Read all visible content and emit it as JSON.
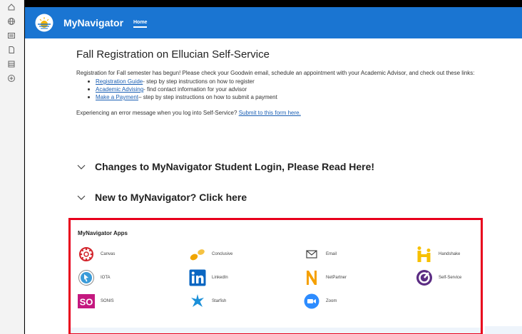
{
  "header": {
    "app_title": "MyNavigator",
    "nav_home": "Home"
  },
  "announcement": {
    "title": "Fall Registration on Ellucian Self-Service",
    "intro": "Registration for Fall semester has begun! Please check your Goodwin email, schedule an appointment with your Academic Advisor, and check out these links:",
    "links": [
      {
        "link": "Registration Guide",
        "desc": " - step by step instructions on how to register"
      },
      {
        "link": "Academic Advising",
        "desc": " - find contact information for your advisor"
      },
      {
        "link": "Make a Payment",
        "desc": " – step by step instructions on how to submit a payment"
      }
    ],
    "error_text": "Experiencing an error message when you log into Self-Service? ",
    "error_link": "Submit to this form here."
  },
  "accordions": [
    "Changes to MyNavigator Student Login, Please Read Here!",
    "New to MyNavigator? Click here"
  ],
  "apps": {
    "title": "MyNavigator Apps",
    "items": [
      {
        "label": "Canvas",
        "icon": "canvas-icon"
      },
      {
        "label": "Conclusive",
        "icon": "conclusive-icon"
      },
      {
        "label": "Email",
        "icon": "email-icon"
      },
      {
        "label": "Handshake",
        "icon": "handshake-icon"
      },
      {
        "label": "IOTA",
        "icon": "iota-icon"
      },
      {
        "label": "LinkedIn",
        "icon": "linkedin-icon"
      },
      {
        "label": "NetPartner",
        "icon": "netpartner-icon"
      },
      {
        "label": "Self-Service",
        "icon": "self-service-icon"
      },
      {
        "label": "SONIS",
        "icon": "sonis-icon"
      },
      {
        "label": "Starfish",
        "icon": "starfish-icon"
      },
      {
        "label": "Zoom",
        "icon": "zoom-icon"
      }
    ]
  },
  "colors": {
    "topbar": "#1a75d2",
    "highlight": "#e8001c"
  }
}
